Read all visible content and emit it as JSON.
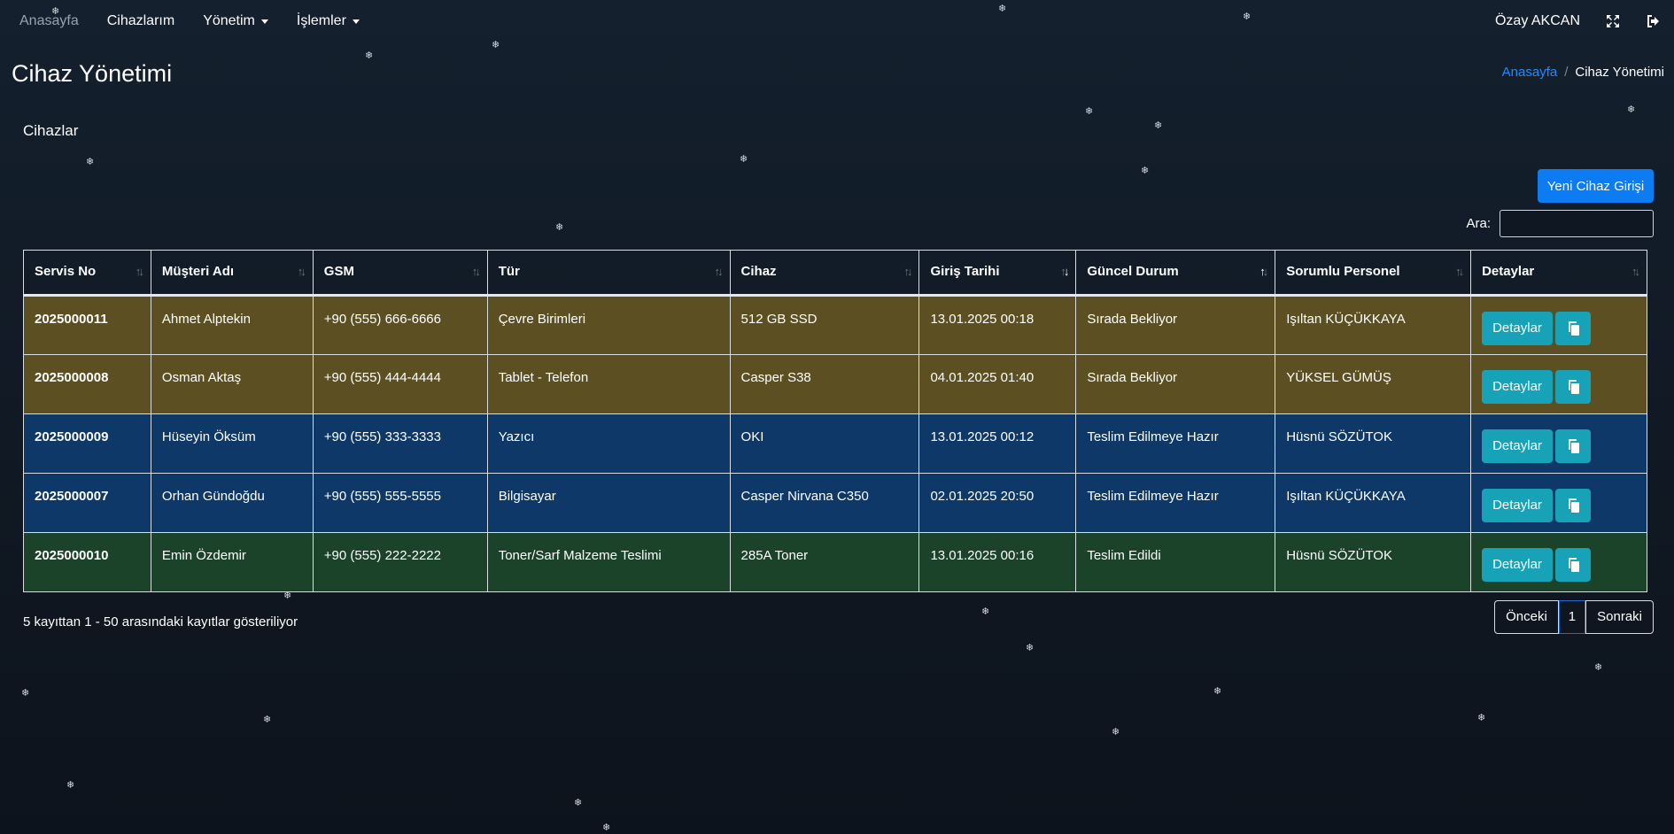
{
  "nav": {
    "brand": "Anasayfa",
    "items": [
      "Cihazlarım",
      "Yönetim",
      "İşlemler"
    ],
    "user": "Özay AKCAN",
    "icons": [
      "expand-icon",
      "logout-icon"
    ]
  },
  "page": {
    "title": "Cihaz Yönetimi"
  },
  "breadcrumb": {
    "home": "Anasayfa",
    "separator": "/",
    "current": "Cihaz Yönetimi"
  },
  "section": {
    "title": "Cihazlar"
  },
  "toolbar": {
    "new_button": "Yeni Cihaz Girişi",
    "search_label": "Ara:",
    "search_value": ""
  },
  "table": {
    "headers": [
      "Servis No",
      "Müşteri Adı",
      "GSM",
      "Tür",
      "Cihaz",
      "Giriş Tarihi",
      "Güncel Durum",
      "Sorumlu Personel",
      "Detaylar"
    ],
    "sort": {
      "Giriş Tarihi": "desc",
      "Güncel Durum": "asc"
    },
    "rows": [
      {
        "servis_no": "2025000011",
        "musteri": "Ahmet Alptekin",
        "gsm": "+90 (555) 666-6666",
        "tur": "Çevre Birimleri",
        "cihaz": "512 GB SSD",
        "tarih": "13.01.2025 00:18",
        "durum": "Sırada Bekliyor",
        "personel": "Işıltan KÜÇÜKKAYA",
        "detail_label": "Detaylar",
        "status_color": "#5c5023"
      },
      {
        "servis_no": "2025000008",
        "musteri": "Osman Aktaş",
        "gsm": "+90 (555) 444-4444",
        "tur": "Tablet - Telefon",
        "cihaz": "Casper S38",
        "tarih": "04.01.2025 01:40",
        "durum": "Sırada Bekliyor",
        "personel": "YÜKSEL GÜMÜŞ",
        "detail_label": "Detaylar",
        "status_color": "#5c5023"
      },
      {
        "servis_no": "2025000009",
        "musteri": "Hüseyin Öksüm",
        "gsm": "+90 (555) 333-3333",
        "tur": "Yazıcı",
        "cihaz": "OKI",
        "tarih": "13.01.2025 00:12",
        "durum": "Teslim Edilmeye Hazır",
        "personel": "Hüsnü SÖZÜTOK",
        "detail_label": "Detaylar",
        "status_color": "#0d3868"
      },
      {
        "servis_no": "2025000007",
        "musteri": "Orhan Gündoğdu",
        "gsm": "+90 (555) 555-5555",
        "tur": "Bilgisayar",
        "cihaz": "Casper Nirvana C350",
        "tarih": "02.01.2025 20:50",
        "durum": "Teslim Edilmeye Hazır",
        "personel": "Işıltan KÜÇÜKKAYA",
        "detail_label": "Detaylar",
        "status_color": "#0d3868"
      },
      {
        "servis_no": "2025000010",
        "musteri": "Emin Özdemir",
        "gsm": "+90 (555) 222-2222",
        "tur": "Toner/Sarf Malzeme Teslimi",
        "cihaz": "285A Toner",
        "tarih": "13.01.2025 00:16",
        "durum": "Teslim Edildi",
        "personel": "Hüsnü SÖZÜTOK",
        "detail_label": "Detaylar",
        "status_color": "#1a432a"
      }
    ]
  },
  "footer": {
    "info": "5 kayıttan 1 - 50 arasındaki kayıtlar gösteriliyor",
    "prev": "Önceki",
    "page": "1",
    "next": "Sonraki"
  },
  "colors": {
    "accent": "#0d7bf2",
    "info_button": "#17a2b8",
    "link": "#1e8cff"
  }
}
